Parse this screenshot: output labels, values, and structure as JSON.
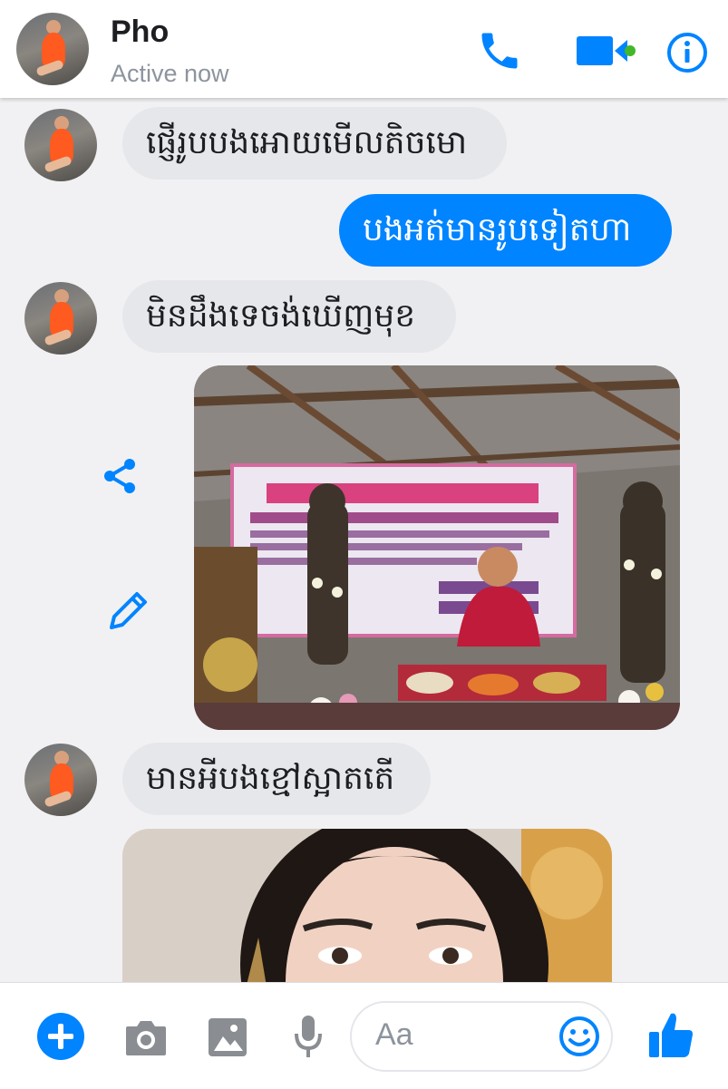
{
  "header": {
    "name": "Pho",
    "status": "Active now",
    "icons": [
      "phone-icon",
      "video-icon",
      "info-icon"
    ],
    "online_color": "#42b72a",
    "accent": "#0084ff"
  },
  "messages": [
    {
      "type": "incoming",
      "text": "ផ្ញើរូបបងអោយមើលតិចមោ"
    },
    {
      "type": "outgoing",
      "text": "បងអត់មានរូបទៀតហា"
    },
    {
      "type": "incoming",
      "text": "មិនដឹងទេចង់ឃើញមុខ"
    },
    {
      "type": "outgoing-photo",
      "photo": "monk-ceremony-photo",
      "actions": [
        "share-icon",
        "edit-icon"
      ]
    },
    {
      "type": "incoming",
      "text": "មានអីបងខ្មៅស្អាតតើ"
    },
    {
      "type": "incoming-photo",
      "photo": "selfie-photo"
    }
  ],
  "composer": {
    "placeholder": "Aa",
    "icons": [
      "plus-icon",
      "camera-icon",
      "gallery-icon",
      "microphone-icon",
      "emoji-icon",
      "like-icon"
    ]
  }
}
